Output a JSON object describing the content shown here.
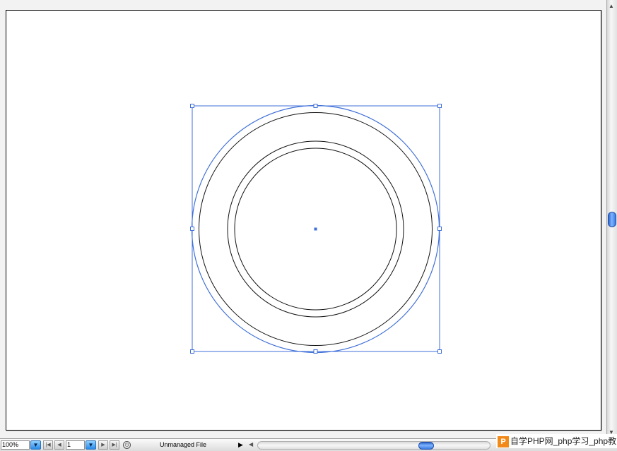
{
  "document": {
    "zoom_level": "100%",
    "page_number": "1",
    "status_text": "Unmanaged File"
  },
  "watermark": {
    "text": "自学PHP网_php学习_php教",
    "logo_letter": "P"
  },
  "selection": {
    "color": "#3f6fd8"
  },
  "icons": {
    "zoom_dropdown": "chevron-down-icon",
    "page_dropdown": "chevron-down-icon",
    "first_page": "first-page-icon",
    "prev_page": "previous-page-icon",
    "next_page": "next-page-icon",
    "last_page": "last-page-icon",
    "status_menu": "triangle-right-icon",
    "scroll_left": "arrow-left-icon"
  }
}
